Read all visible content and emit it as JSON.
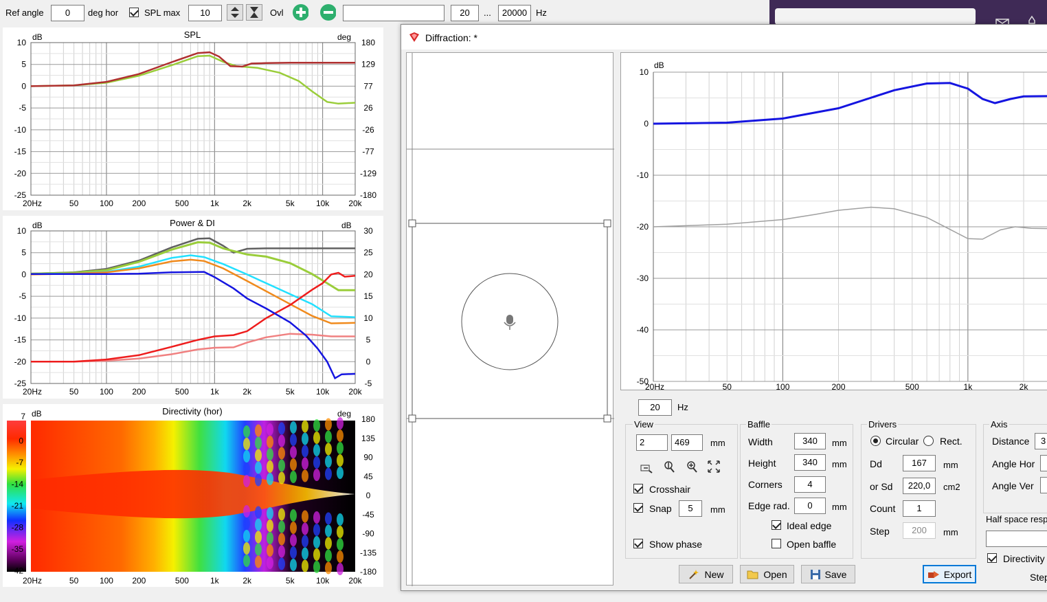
{
  "toolbar": {
    "ref_angle_label": "Ref angle",
    "ref_angle_value": "0",
    "deg_hor_label": "deg hor",
    "spl_max_label": "SPL max",
    "spl_max_value": "10",
    "ovl_label": "Ovl",
    "freq_min": "20",
    "ellipsis": "...",
    "freq_max": "20000",
    "hz_label": "Hz"
  },
  "charts": {
    "spl": {
      "title": "SPL",
      "unit_left": "dB",
      "unit_right": "deg",
      "y_left": [
        "10",
        "5",
        "0",
        "-5",
        "-10",
        "-15",
        "-20",
        "-25"
      ],
      "y_right": [
        "180",
        "129",
        "77",
        "26",
        "-26",
        "-77",
        "-129",
        "-180"
      ],
      "x_ticks": [
        "20Hz",
        "50",
        "100",
        "200",
        "500",
        "1k",
        "2k",
        "5k",
        "10k",
        "20k"
      ]
    },
    "power": {
      "title": "Power & DI",
      "unit_left": "dB",
      "unit_right": "dB",
      "y_left": [
        "10",
        "5",
        "0",
        "-5",
        "-10",
        "-15",
        "-20",
        "-25"
      ],
      "y_right": [
        "30",
        "25",
        "20",
        "15",
        "10",
        "5",
        "0",
        "-5"
      ],
      "x_ticks": [
        "20Hz",
        "50",
        "100",
        "200",
        "500",
        "1k",
        "2k",
        "5k",
        "10k",
        "20k"
      ]
    },
    "directivity": {
      "title": "Directivity (hor)",
      "unit_left": "dB",
      "unit_right": "deg",
      "scale": [
        "7",
        "0",
        "-7",
        "-14",
        "-21",
        "-28",
        "-35",
        "-42"
      ],
      "y_right": [
        "180",
        "135",
        "90",
        "45",
        "0",
        "-45",
        "-90",
        "-135",
        "-180"
      ],
      "x_ticks": [
        "20Hz",
        "50",
        "100",
        "200",
        "500",
        "1k",
        "2k",
        "5k",
        "10k",
        "20k"
      ]
    },
    "diffraction": {
      "unit_left": "dB",
      "y_left": [
        "10",
        "0",
        "-10",
        "-20",
        "-30",
        "-40",
        "-50"
      ],
      "x_ticks": [
        "20Hz",
        "50",
        "100",
        "200",
        "500",
        "1k",
        "2k"
      ]
    }
  },
  "dialog": {
    "title": "Diffraction: *",
    "freq_value": "20",
    "freq_unit": "Hz",
    "view": {
      "label": "View",
      "min": "2",
      "max": "469",
      "unit": "mm",
      "crosshair": "Crosshair",
      "snap": "Snap",
      "snap_value": "5",
      "snap_unit": "mm",
      "show_phase": "Show phase"
    },
    "baffle": {
      "label": "Baffle",
      "width_label": "Width",
      "width_value": "340",
      "width_unit": "mm",
      "height_label": "Height",
      "height_value": "340",
      "height_unit": "mm",
      "corners_label": "Corners",
      "corners_value": "4",
      "edge_label": "Edge rad.",
      "edge_value": "0",
      "edge_unit": "mm",
      "ideal_edge": "Ideal edge",
      "open_baffle": "Open baffle"
    },
    "drivers": {
      "label": "Drivers",
      "circular": "Circular",
      "rect": "Rect.",
      "dd_label": "Dd",
      "dd_value": "167",
      "dd_unit": "mm",
      "sd_label": "or Sd",
      "sd_value": "220,0",
      "sd_unit": "cm2",
      "count_label": "Count",
      "count_value": "1",
      "step_label": "Step",
      "step_value": "200",
      "step_unit": "mm"
    },
    "axis": {
      "label": "Axis",
      "distance_label": "Distance",
      "distance_value": "3",
      "angle_hor_label": "Angle Hor",
      "angle_ver_label": "Angle Ver",
      "half_space_label": "Half space resp",
      "directivity_label": "Directivity",
      "step_label": "Step"
    },
    "buttons": {
      "new": "New",
      "open": "Open",
      "save": "Save",
      "export": "Export"
    }
  },
  "colors": {
    "spl_red": "#b03030",
    "spl_green": "#9acd3a",
    "blue": "#1515e0",
    "red": "#ee1c1c",
    "pink": "#f08080",
    "orange": "#f08a1c",
    "cyan": "#22e0ff",
    "gray": "#606060",
    "title_bar_accent": "#d72828"
  }
}
